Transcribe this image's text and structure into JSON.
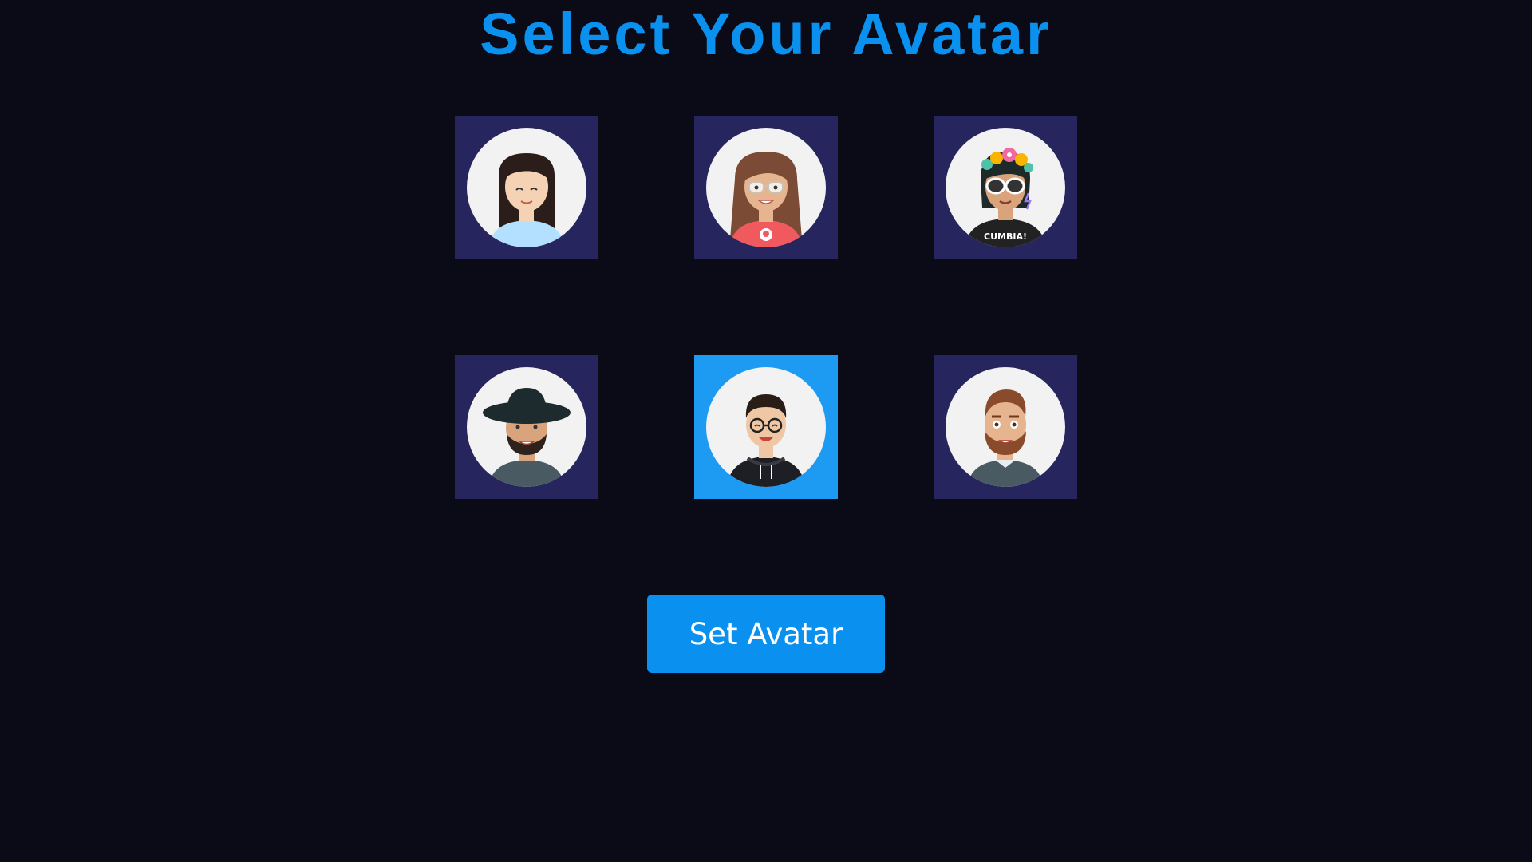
{
  "page": {
    "title": "Select Your Avatar",
    "submit_label": "Set Avatar",
    "selected_index": 4
  },
  "colors": {
    "background": "#0b0b17",
    "accent": "#0a91f0",
    "tile": "#26255d",
    "tile_selected": "#1d9bf3"
  },
  "avatars": [
    {
      "icon": "woman-black-hair-avatar-icon"
    },
    {
      "icon": "woman-glasses-red-shirt-avatar-icon"
    },
    {
      "icon": "woman-flower-crown-sunglasses-avatar-icon",
      "shirt_text": "CUMBIA!"
    },
    {
      "icon": "man-hat-beard-avatar-icon"
    },
    {
      "icon": "man-glasses-hoodie-avatar-icon"
    },
    {
      "icon": "man-beard-avatar-icon"
    }
  ]
}
